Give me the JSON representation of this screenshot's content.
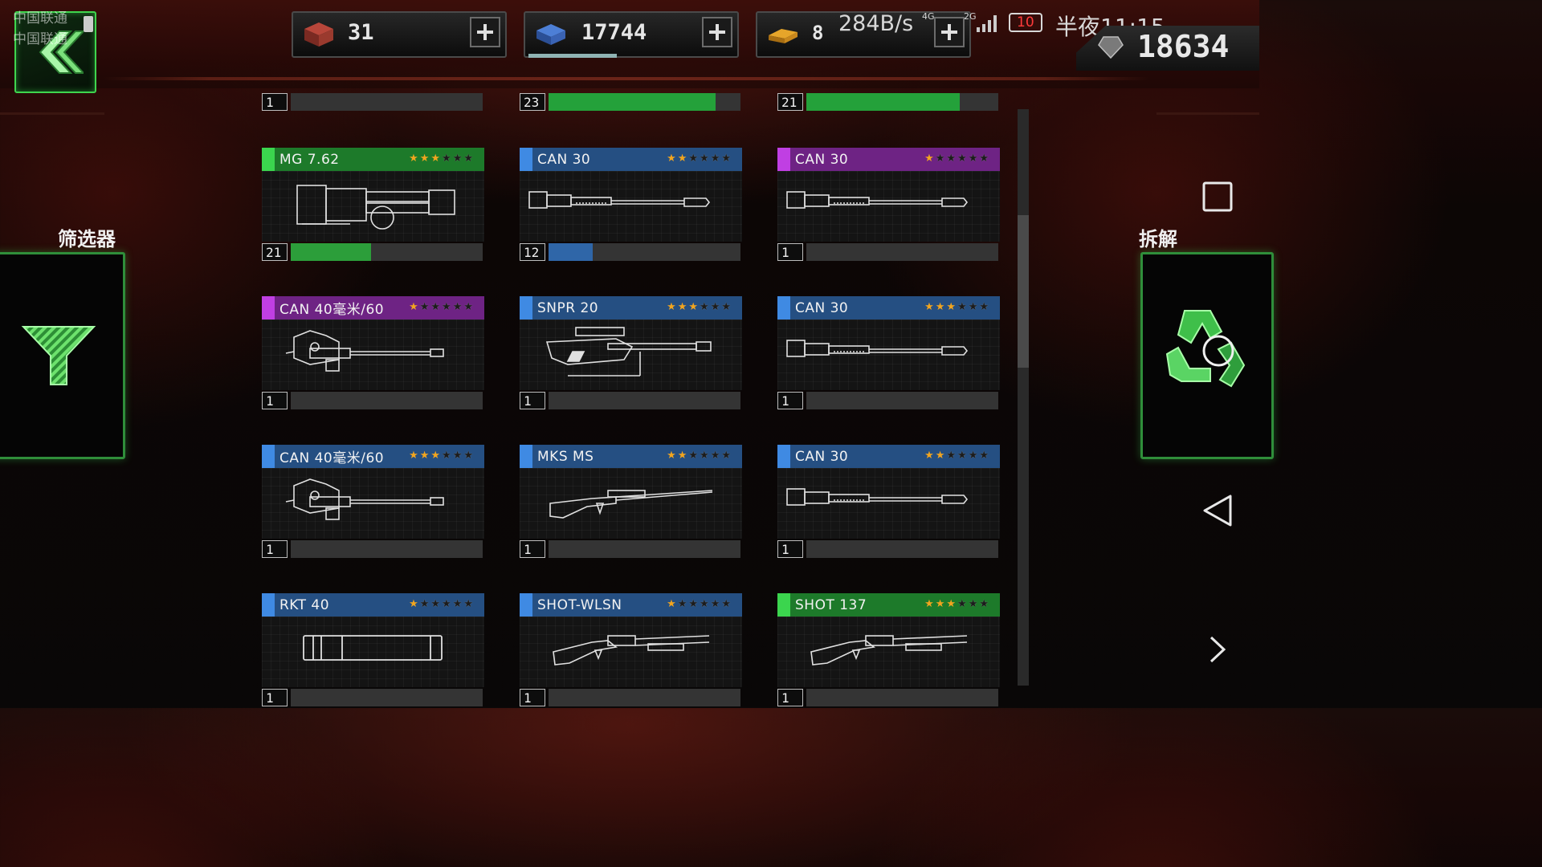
{
  "status_bar": {
    "carrier1": "中国联通",
    "carrier2": "中国联通",
    "speed": "284B/s",
    "net1": "4G",
    "net2": "2G",
    "battery": "10",
    "time": "半夜11:15"
  },
  "resources": [
    {
      "name": "crates",
      "icon": "crate-icon",
      "value": "31"
    },
    {
      "name": "alloy",
      "icon": "alloy-stack-icon",
      "value": "17744",
      "progress": 0.43
    },
    {
      "name": "gold",
      "icon": "gold-bars-icon",
      "value": "8"
    }
  ],
  "gems": {
    "icon": "gem-icon",
    "value": "18634"
  },
  "left_panel": {
    "label": "筛选器",
    "icon": "funnel-icon"
  },
  "right_panel": {
    "label": "拆解",
    "icon": "recycle-icon"
  },
  "colors": {
    "green": "#24a13a",
    "blue": "#2f66a8",
    "purple": "#8e2fa8",
    "accent_green": "#3fd54e",
    "star": "#f2a51f"
  },
  "top_row": [
    {
      "level": "1",
      "progress": 0.0,
      "fill_color": "#2f66a8"
    },
    {
      "level": "23",
      "progress": 0.87,
      "fill_color": "#24a13a"
    },
    {
      "level": "21",
      "progress": 0.8,
      "fill_color": "#24a13a"
    }
  ],
  "weapons": [
    {
      "name": "MG 7.62",
      "rarity": "green",
      "stars": 3,
      "level": "21",
      "progress": 0.42,
      "icon": "minigun-icon"
    },
    {
      "name": "CAN 30",
      "rarity": "blue",
      "stars": 2,
      "level": "12",
      "progress": 0.23,
      "icon": "cannon-30-icon"
    },
    {
      "name": "CAN 30",
      "rarity": "purple",
      "stars": 1,
      "level": "1",
      "progress": 0.0,
      "icon": "cannon-30-icon"
    },
    {
      "name": "CAN 40毫米/60",
      "rarity": "purple",
      "stars": 1,
      "level": "1",
      "progress": 0.0,
      "icon": "cannon-40-icon"
    },
    {
      "name": "SNPR 20",
      "rarity": "blue",
      "stars": 3,
      "level": "1",
      "progress": 0.0,
      "icon": "sniper-rifle-icon"
    },
    {
      "name": "CAN 30",
      "rarity": "blue",
      "stars": 3,
      "level": "1",
      "progress": 0.0,
      "icon": "cannon-30-icon"
    },
    {
      "name": "CAN 40毫米/60",
      "rarity": "blue",
      "stars": 3,
      "level": "1",
      "progress": 0.0,
      "icon": "cannon-40-icon"
    },
    {
      "name": "MKS MS",
      "rarity": "blue",
      "stars": 2,
      "level": "1",
      "progress": 0.0,
      "icon": "marksman-rifle-icon"
    },
    {
      "name": "CAN 30",
      "rarity": "blue",
      "stars": 2,
      "level": "1",
      "progress": 0.0,
      "icon": "cannon-30-icon"
    },
    {
      "name": "RKT 40",
      "rarity": "blue",
      "stars": 1,
      "level": "1",
      "progress": 0.0,
      "icon": "rocket-tube-icon"
    },
    {
      "name": "SHOT-WLSN",
      "rarity": "blue",
      "stars": 1,
      "level": "1",
      "progress": 0.0,
      "icon": "shotgun-icon"
    },
    {
      "name": "SHOT 137",
      "rarity": "green",
      "stars": 3,
      "level": "1",
      "progress": 0.0,
      "icon": "shotgun-icon"
    }
  ]
}
